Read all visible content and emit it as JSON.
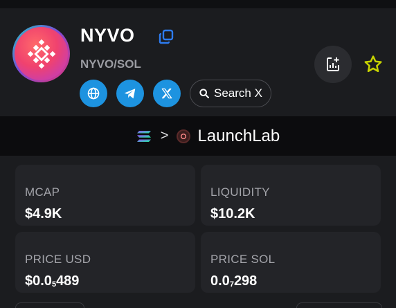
{
  "token": {
    "name": "NYVO",
    "pair": "NYVO/SOL"
  },
  "socials": {
    "website_icon": "globe-icon",
    "telegram_icon": "telegram-icon",
    "x_icon": "x-icon",
    "search_label": "Search X"
  },
  "actions": {
    "chart_icon": "chart-add-icon",
    "favorite_icon": "star-icon"
  },
  "launch": {
    "chain_icon": "solana-icon",
    "separator": ">",
    "platform_icon": "launchlab-icon",
    "platform_label": "LaunchLab"
  },
  "stats": {
    "mcap": {
      "label": "MCAP",
      "value": "$4.9K"
    },
    "liquidity": {
      "label": "LIQUIDITY",
      "value": "$10.2K"
    },
    "price_usd": {
      "label": "PRICE USD",
      "prefix": "$0.0",
      "sub": "5",
      "rest": "489"
    },
    "price_sol": {
      "label": "PRICE SOL",
      "prefix": "0.0",
      "sub": "7",
      "rest": "298"
    }
  },
  "colors": {
    "background": "#1b1c1f",
    "card": "#232428",
    "social_blue": "#1d93e0",
    "copy_blue": "#2d7bf0",
    "star_yellow": "#c8d400",
    "muted_text": "#9b9ca2"
  }
}
